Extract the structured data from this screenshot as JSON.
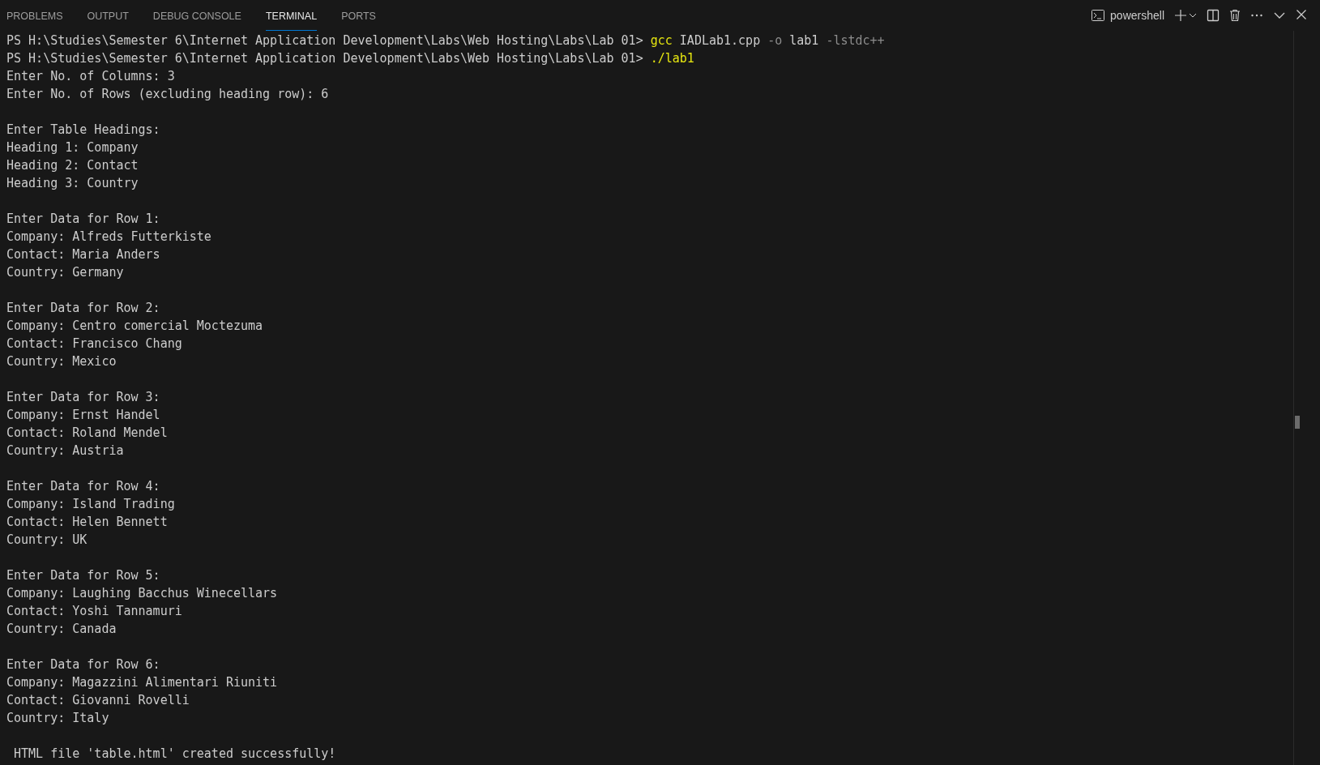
{
  "tabs": [
    {
      "label": "PROBLEMS",
      "selected": false
    },
    {
      "label": "OUTPUT",
      "selected": false
    },
    {
      "label": "DEBUG CONSOLE",
      "selected": false
    },
    {
      "label": "TERMINAL",
      "selected": true
    },
    {
      "label": "PORTS",
      "selected": false
    }
  ],
  "toolbar": {
    "shell": "powershell"
  },
  "terminal": {
    "lines": [
      {
        "kind": "command",
        "prompt": "PS H:\\Studies\\Semester 6\\Internet Application Development\\Labs\\Web Hosting\\Labs\\Lab 01> ",
        "tokens": [
          {
            "text": "gcc",
            "kind": "program"
          },
          {
            "text": "IADLab1.cpp",
            "kind": "argument"
          },
          {
            "text": "-o",
            "kind": "flag"
          },
          {
            "text": "lab1",
            "kind": "argument"
          },
          {
            "text": "-lstdc++",
            "kind": "flag"
          }
        ]
      },
      {
        "kind": "command",
        "prompt": "PS H:\\Studies\\Semester 6\\Internet Application Development\\Labs\\Web Hosting\\Labs\\Lab 01> ",
        "tokens": [
          {
            "text": "./lab1",
            "kind": "program"
          }
        ]
      },
      {
        "kind": "output",
        "text": "Enter No. of Columns: 3"
      },
      {
        "kind": "output",
        "text": "Enter No. of Rows (excluding heading row): 6"
      },
      {
        "kind": "blank"
      },
      {
        "kind": "output",
        "text": "Enter Table Headings:"
      },
      {
        "kind": "output",
        "text": "Heading 1: Company"
      },
      {
        "kind": "output",
        "text": "Heading 2: Contact"
      },
      {
        "kind": "output",
        "text": "Heading 3: Country"
      },
      {
        "kind": "blank"
      },
      {
        "kind": "output",
        "text": "Enter Data for Row 1:"
      },
      {
        "kind": "output",
        "text": "Company: Alfreds Futterkiste"
      },
      {
        "kind": "output",
        "text": "Contact: Maria Anders"
      },
      {
        "kind": "output",
        "text": "Country: Germany"
      },
      {
        "kind": "blank"
      },
      {
        "kind": "output",
        "text": "Enter Data for Row 2:"
      },
      {
        "kind": "output",
        "text": "Company: Centro comercial Moctezuma"
      },
      {
        "kind": "output",
        "text": "Contact: Francisco Chang"
      },
      {
        "kind": "output",
        "text": "Country: Mexico"
      },
      {
        "kind": "blank"
      },
      {
        "kind": "output",
        "text": "Enter Data for Row 3:"
      },
      {
        "kind": "output",
        "text": "Company: Ernst Handel"
      },
      {
        "kind": "output",
        "text": "Contact: Roland Mendel"
      },
      {
        "kind": "output",
        "text": "Country: Austria"
      },
      {
        "kind": "blank"
      },
      {
        "kind": "output",
        "text": "Enter Data for Row 4:"
      },
      {
        "kind": "output",
        "text": "Company: Island Trading"
      },
      {
        "kind": "output",
        "text": "Contact: Helen Bennett"
      },
      {
        "kind": "output",
        "text": "Country: UK"
      },
      {
        "kind": "blank"
      },
      {
        "kind": "output",
        "text": "Enter Data for Row 5:"
      },
      {
        "kind": "output",
        "text": "Company: Laughing Bacchus Winecellars"
      },
      {
        "kind": "output",
        "text": "Contact: Yoshi Tannamuri"
      },
      {
        "kind": "output",
        "text": "Country: Canada"
      },
      {
        "kind": "blank"
      },
      {
        "kind": "output",
        "text": "Enter Data for Row 6:"
      },
      {
        "kind": "output",
        "text": "Company: Magazzini Alimentari Riuniti"
      },
      {
        "kind": "output",
        "text": "Contact: Giovanni Rovelli"
      },
      {
        "kind": "output",
        "text": "Country: Italy"
      },
      {
        "kind": "blank"
      },
      {
        "kind": "output",
        "text": " HTML file 'table.html' created successfully!"
      }
    ]
  }
}
